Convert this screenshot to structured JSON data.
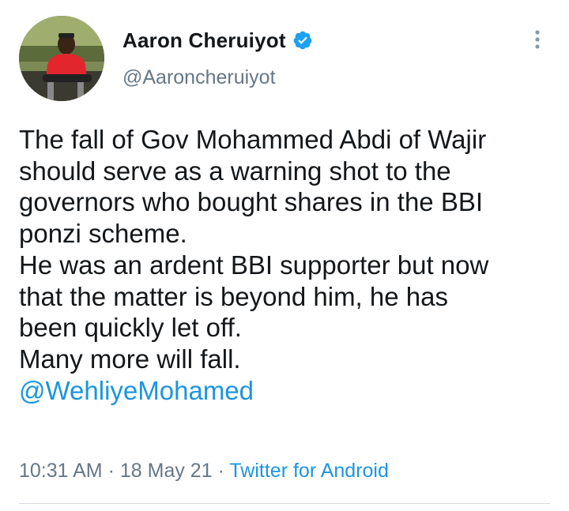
{
  "author": {
    "display_name": "Aaron Cheruiyot",
    "handle": "@Aaroncheruiyot",
    "verified": true,
    "verified_color": "#1da1f2"
  },
  "tweet": {
    "lines": [
      "The fall of Gov Mohammed Abdi of Wajir",
      "should serve as a warning shot to the",
      "governors who bought shares in the BBI",
      "ponzi scheme.",
      "He was an ardent BBI supporter but now",
      "that the matter is beyond him, he has",
      "been quickly let off.",
      "Many more will fall."
    ],
    "mention": "@WehliyeMohamed"
  },
  "meta": {
    "time": "10:31 AM",
    "separator": "·",
    "date": "18 May 21",
    "source": "Twitter for Android"
  },
  "icons": {
    "more": "more-vertical-icon",
    "verified": "verified-badge-icon"
  },
  "colors": {
    "link": "#1b95e0",
    "secondary_text": "#657786",
    "primary_text": "#14171a"
  }
}
